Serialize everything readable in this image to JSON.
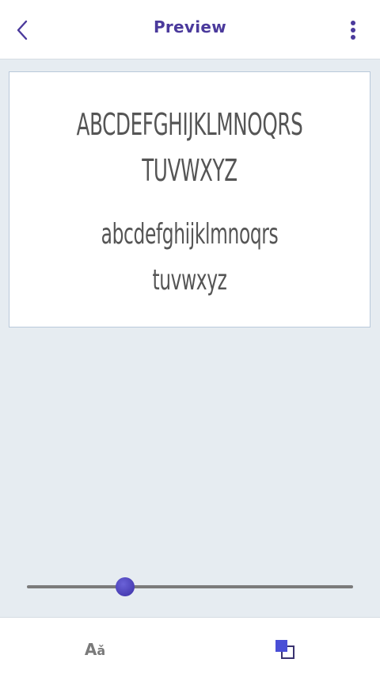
{
  "header": {
    "title": "Preview",
    "back_icon": "chevron-left-icon",
    "menu_icon": "more-vertical-icon"
  },
  "preview": {
    "uppercase_line1": "ABCDEFGHIJKLMNOQRS",
    "uppercase_line2": "TUVWXYZ",
    "lowercase_line1": "abcdefghijklmnoqrs",
    "lowercase_line2": "tuvwxyz",
    "text_color": "#555555"
  },
  "size_slider": {
    "value_fraction": 0.3
  },
  "bottom_bar": {
    "font_size_label_big": "A",
    "font_size_label_small": "ǎ",
    "font_size_icon": "font-size-icon",
    "color_icon": "color-swap-icon"
  },
  "colors": {
    "accent": "#4b3a9c",
    "background": "#e6ecf1",
    "slider_thumb": "#4a40bd"
  }
}
